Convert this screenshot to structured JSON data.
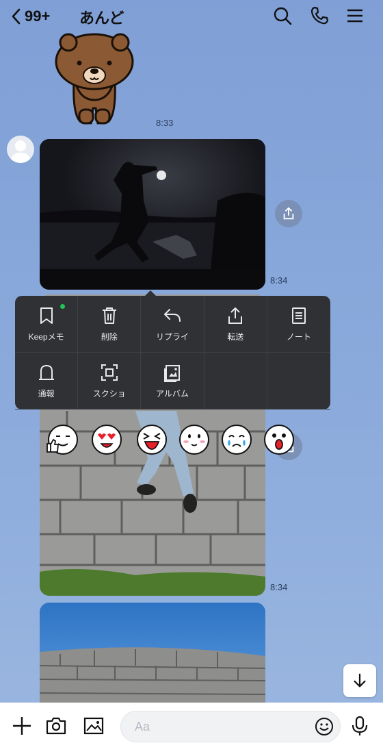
{
  "header": {
    "unread_count": "99+",
    "title": "あんど"
  },
  "messages": {
    "time1": "8:33",
    "time2": "8:34",
    "time3": "8:34"
  },
  "menu": {
    "items": [
      {
        "label": "Keepメモ",
        "icon": "bookmark-icon"
      },
      {
        "label": "削除",
        "icon": "trash-icon"
      },
      {
        "label": "リプライ",
        "icon": "reply-icon"
      },
      {
        "label": "転送",
        "icon": "share-icon"
      },
      {
        "label": "ノート",
        "icon": "note-icon"
      },
      {
        "label": "通報",
        "icon": "bell-report-icon"
      },
      {
        "label": "スクショ",
        "icon": "screenshot-icon"
      },
      {
        "label": "アルバム",
        "icon": "album-icon"
      }
    ]
  },
  "composer": {
    "placeholder": "Aa"
  },
  "colors": {
    "background": "#8aaad8",
    "menu_bg": "#2f3135",
    "keep_dot": "#20c45a"
  }
}
